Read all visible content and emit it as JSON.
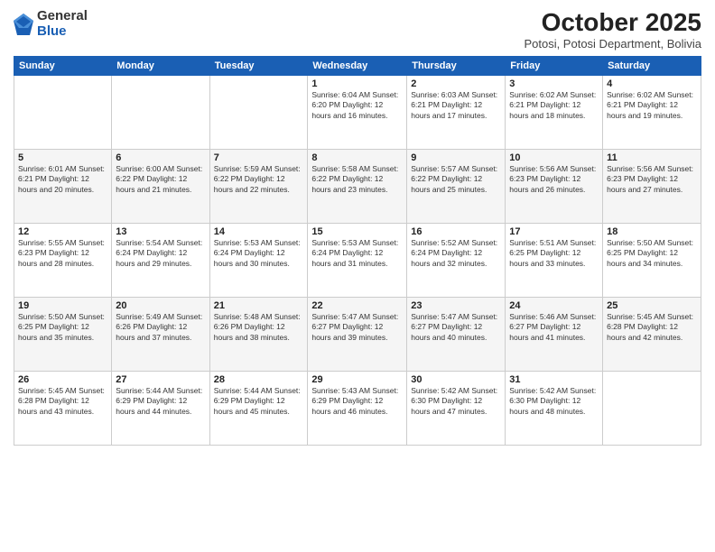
{
  "logo": {
    "general": "General",
    "blue": "Blue"
  },
  "title": "October 2025",
  "subtitle": "Potosi, Potosi Department, Bolivia",
  "days_header": [
    "Sunday",
    "Monday",
    "Tuesday",
    "Wednesday",
    "Thursday",
    "Friday",
    "Saturday"
  ],
  "weeks": [
    [
      {
        "day": "",
        "info": ""
      },
      {
        "day": "",
        "info": ""
      },
      {
        "day": "",
        "info": ""
      },
      {
        "day": "1",
        "info": "Sunrise: 6:04 AM\nSunset: 6:20 PM\nDaylight: 12 hours\nand 16 minutes."
      },
      {
        "day": "2",
        "info": "Sunrise: 6:03 AM\nSunset: 6:21 PM\nDaylight: 12 hours\nand 17 minutes."
      },
      {
        "day": "3",
        "info": "Sunrise: 6:02 AM\nSunset: 6:21 PM\nDaylight: 12 hours\nand 18 minutes."
      },
      {
        "day": "4",
        "info": "Sunrise: 6:02 AM\nSunset: 6:21 PM\nDaylight: 12 hours\nand 19 minutes."
      }
    ],
    [
      {
        "day": "5",
        "info": "Sunrise: 6:01 AM\nSunset: 6:21 PM\nDaylight: 12 hours\nand 20 minutes."
      },
      {
        "day": "6",
        "info": "Sunrise: 6:00 AM\nSunset: 6:22 PM\nDaylight: 12 hours\nand 21 minutes."
      },
      {
        "day": "7",
        "info": "Sunrise: 5:59 AM\nSunset: 6:22 PM\nDaylight: 12 hours\nand 22 minutes."
      },
      {
        "day": "8",
        "info": "Sunrise: 5:58 AM\nSunset: 6:22 PM\nDaylight: 12 hours\nand 23 minutes."
      },
      {
        "day": "9",
        "info": "Sunrise: 5:57 AM\nSunset: 6:22 PM\nDaylight: 12 hours\nand 25 minutes."
      },
      {
        "day": "10",
        "info": "Sunrise: 5:56 AM\nSunset: 6:23 PM\nDaylight: 12 hours\nand 26 minutes."
      },
      {
        "day": "11",
        "info": "Sunrise: 5:56 AM\nSunset: 6:23 PM\nDaylight: 12 hours\nand 27 minutes."
      }
    ],
    [
      {
        "day": "12",
        "info": "Sunrise: 5:55 AM\nSunset: 6:23 PM\nDaylight: 12 hours\nand 28 minutes."
      },
      {
        "day": "13",
        "info": "Sunrise: 5:54 AM\nSunset: 6:24 PM\nDaylight: 12 hours\nand 29 minutes."
      },
      {
        "day": "14",
        "info": "Sunrise: 5:53 AM\nSunset: 6:24 PM\nDaylight: 12 hours\nand 30 minutes."
      },
      {
        "day": "15",
        "info": "Sunrise: 5:53 AM\nSunset: 6:24 PM\nDaylight: 12 hours\nand 31 minutes."
      },
      {
        "day": "16",
        "info": "Sunrise: 5:52 AM\nSunset: 6:24 PM\nDaylight: 12 hours\nand 32 minutes."
      },
      {
        "day": "17",
        "info": "Sunrise: 5:51 AM\nSunset: 6:25 PM\nDaylight: 12 hours\nand 33 minutes."
      },
      {
        "day": "18",
        "info": "Sunrise: 5:50 AM\nSunset: 6:25 PM\nDaylight: 12 hours\nand 34 minutes."
      }
    ],
    [
      {
        "day": "19",
        "info": "Sunrise: 5:50 AM\nSunset: 6:25 PM\nDaylight: 12 hours\nand 35 minutes."
      },
      {
        "day": "20",
        "info": "Sunrise: 5:49 AM\nSunset: 6:26 PM\nDaylight: 12 hours\nand 37 minutes."
      },
      {
        "day": "21",
        "info": "Sunrise: 5:48 AM\nSunset: 6:26 PM\nDaylight: 12 hours\nand 38 minutes."
      },
      {
        "day": "22",
        "info": "Sunrise: 5:47 AM\nSunset: 6:27 PM\nDaylight: 12 hours\nand 39 minutes."
      },
      {
        "day": "23",
        "info": "Sunrise: 5:47 AM\nSunset: 6:27 PM\nDaylight: 12 hours\nand 40 minutes."
      },
      {
        "day": "24",
        "info": "Sunrise: 5:46 AM\nSunset: 6:27 PM\nDaylight: 12 hours\nand 41 minutes."
      },
      {
        "day": "25",
        "info": "Sunrise: 5:45 AM\nSunset: 6:28 PM\nDaylight: 12 hours\nand 42 minutes."
      }
    ],
    [
      {
        "day": "26",
        "info": "Sunrise: 5:45 AM\nSunset: 6:28 PM\nDaylight: 12 hours\nand 43 minutes."
      },
      {
        "day": "27",
        "info": "Sunrise: 5:44 AM\nSunset: 6:29 PM\nDaylight: 12 hours\nand 44 minutes."
      },
      {
        "day": "28",
        "info": "Sunrise: 5:44 AM\nSunset: 6:29 PM\nDaylight: 12 hours\nand 45 minutes."
      },
      {
        "day": "29",
        "info": "Sunrise: 5:43 AM\nSunset: 6:29 PM\nDaylight: 12 hours\nand 46 minutes."
      },
      {
        "day": "30",
        "info": "Sunrise: 5:42 AM\nSunset: 6:30 PM\nDaylight: 12 hours\nand 47 minutes."
      },
      {
        "day": "31",
        "info": "Sunrise: 5:42 AM\nSunset: 6:30 PM\nDaylight: 12 hours\nand 48 minutes."
      },
      {
        "day": "",
        "info": ""
      }
    ]
  ]
}
